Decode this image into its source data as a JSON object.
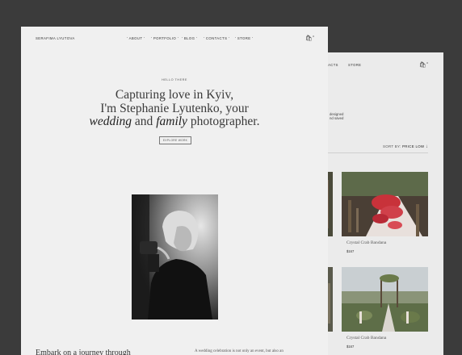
{
  "front": {
    "nav": {
      "brand": "SERAFIMA LYUTOVA",
      "items": [
        "ABOUT",
        "PORTFOLIO",
        "BLOG",
        "CONTACTS",
        "STORE"
      ],
      "cart_count": "0"
    },
    "hero": {
      "eyebrow": "HELLO THERE",
      "line1": "Capturing love in Kyiv,",
      "line2": "I'm Stephanie Lyutenko, your",
      "word_wedding": "wedding",
      "word_and": "and",
      "word_family": "family",
      "word_photographer": "photographer.",
      "cta_label": "EXPLORE WORK"
    },
    "bottom": {
      "left": "Embark on a journey through",
      "right": "A wedding celebration is not only an event, but also an"
    }
  },
  "back": {
    "nav": {
      "item_contacts": "CTACTS",
      "item_store": "STORE",
      "cart_count": "0"
    },
    "description": [
      "designed",
      "nd saved"
    ],
    "sort": {
      "label": "SORT BY:",
      "value": "PRICE LOW"
    },
    "products": [
      {
        "title": "Crystal Crab Bandana",
        "price": "$167"
      },
      {
        "title": "Crystal Crab Bandana",
        "price": "$167"
      }
    ]
  },
  "icons": {
    "cart": "shopping-bag-icon",
    "sort": "sort-arrow-icon"
  }
}
